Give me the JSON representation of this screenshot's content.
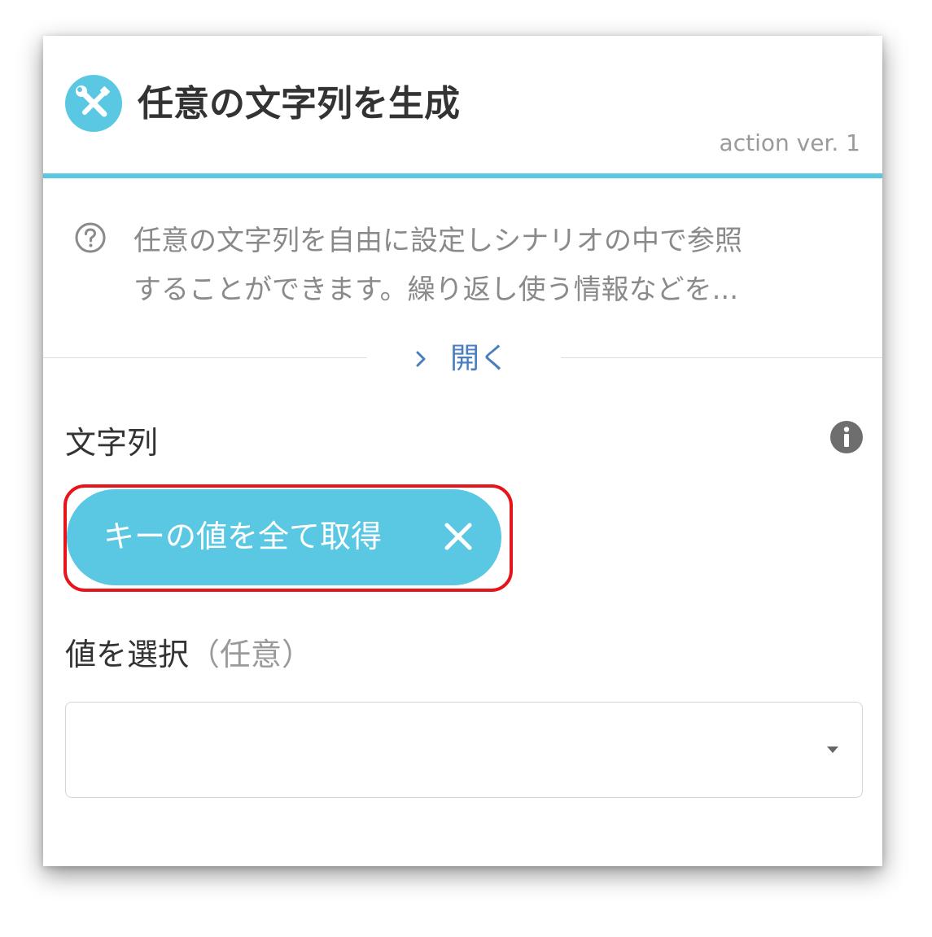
{
  "header": {
    "icon": "tools-icon",
    "title": "任意の文字列を生成",
    "version": "action ver. 1"
  },
  "description": {
    "icon": "question-circle-icon",
    "lines": [
      "任意の文字列を自由に設定しシナリオの中で参照",
      "することができます。繰り返し使う情報などを..."
    ],
    "toggle_label": "開く",
    "toggle_icon": "chevron-right-icon"
  },
  "string_field": {
    "label": "文字列",
    "info_icon": "info-icon",
    "chip_label": "キーの値を全て取得",
    "chip_close_icon": "close-icon",
    "highlighted": true
  },
  "select_field": {
    "label": "値を選択",
    "optional_label": "（任意）",
    "value": "",
    "dropdown_icon": "dropdown-arrow-icon"
  },
  "colors": {
    "accent": "#5bc8e3",
    "link": "#4a7fbf",
    "highlight": "#e8141b",
    "text": "#333333",
    "muted": "#8a8a8a"
  }
}
